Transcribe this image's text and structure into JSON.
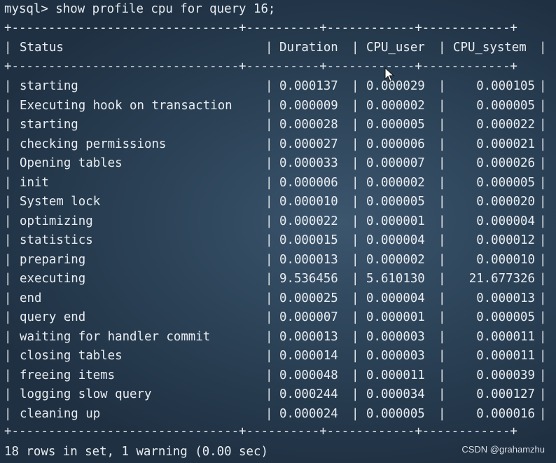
{
  "command": "mysql> show profile cpu for query 16;",
  "border": "+-------------------------------+----------+------------+------------+",
  "headers": [
    "Status",
    "Duration",
    "CPU_user",
    "CPU_system"
  ],
  "rows": [
    [
      "starting",
      "0.000137",
      "0.000029",
      "0.000105"
    ],
    [
      "Executing hook on transaction",
      "0.000009",
      "0.000002",
      "0.000005"
    ],
    [
      "starting",
      "0.000028",
      "0.000005",
      "0.000022"
    ],
    [
      "checking permissions",
      "0.000027",
      "0.000006",
      "0.000021"
    ],
    [
      "Opening tables",
      "0.000033",
      "0.000007",
      "0.000026"
    ],
    [
      "init",
      "0.000006",
      "0.000002",
      "0.000005"
    ],
    [
      "System lock",
      "0.000010",
      "0.000005",
      "0.000020"
    ],
    [
      "optimizing",
      "0.000022",
      "0.000001",
      "0.000004"
    ],
    [
      "statistics",
      "0.000015",
      "0.000004",
      "0.000012"
    ],
    [
      "preparing",
      "0.000013",
      "0.000002",
      "0.000010"
    ],
    [
      "executing",
      "9.536456",
      "5.610130",
      "21.677326"
    ],
    [
      "end",
      "0.000025",
      "0.000004",
      "0.000013"
    ],
    [
      "query end",
      "0.000007",
      "0.000001",
      "0.000005"
    ],
    [
      "waiting for handler commit",
      "0.000013",
      "0.000003",
      "0.000011"
    ],
    [
      "closing tables",
      "0.000014",
      "0.000003",
      "0.000011"
    ],
    [
      "freeing items",
      "0.000048",
      "0.000011",
      "0.000039"
    ],
    [
      "logging slow query",
      "0.000244",
      "0.000034",
      "0.000127"
    ],
    [
      "cleaning up",
      "0.000024",
      "0.000005",
      "0.000016"
    ]
  ],
  "footer": "18 rows in set, 1 warning (0.00 sec)",
  "watermark": "CSDN @grahamzhu",
  "icons": {
    "cursor": "mouse-pointer-icon"
  },
  "colors": {
    "text": "#e9edf1",
    "background": "#2d4459"
  }
}
